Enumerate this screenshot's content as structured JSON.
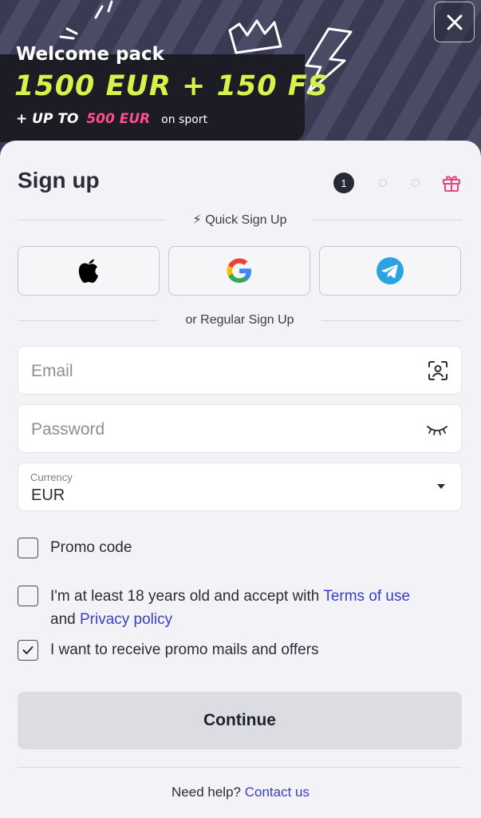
{
  "promo": {
    "welcome_title": "Welcome pack",
    "main_offer": "1500 EUR + 150 FS",
    "sub_offer_prefix": "+ UP TO",
    "sub_offer_amount": "500 EUR",
    "sub_offer_suffix": "on sport",
    "accent_color": "#d7f24a",
    "pink_color": "#ff4f8b"
  },
  "signup": {
    "title": "Sign up",
    "active_step": "1",
    "quick_signup_label": "⚡ Quick Sign Up",
    "regular_signup_label": "or Regular Sign Up",
    "social_buttons": [
      "apple-icon",
      "google-icon",
      "telegram-icon"
    ]
  },
  "form": {
    "email_placeholder": "Email",
    "password_placeholder": "Password",
    "currency_label": "Currency",
    "currency_value": "EUR"
  },
  "checkboxes": {
    "promo_code_label": "Promo code",
    "age_text_1": "I'm at least 18 years old and accept with",
    "terms_link": "Terms of use",
    "age_text_2": "and",
    "privacy_link": "Privacy policy",
    "promo_mails_label": "I want to receive promo mails and offers",
    "promo_mails_checked": true
  },
  "actions": {
    "continue_label": "Continue",
    "help_text": "Need help?",
    "contact_link": "Contact us"
  }
}
